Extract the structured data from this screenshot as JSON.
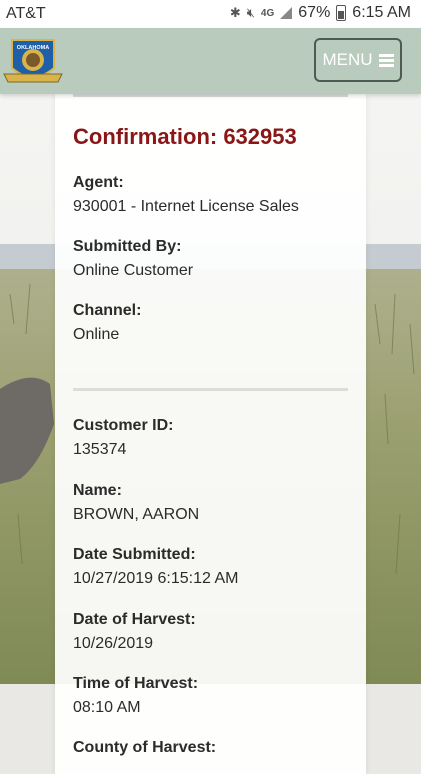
{
  "status_bar": {
    "carrier": "AT&T",
    "battery": "67%",
    "time": "6:15 AM",
    "network": "4G",
    "icons": [
      "bluetooth-icon",
      "mute-icon",
      "network-4g-icon",
      "signal-icon",
      "battery-icon"
    ]
  },
  "header": {
    "logo_text": "OKLAHOMA",
    "menu_label": "MENU",
    "background_color": "#b9cbbd"
  },
  "confirmation": {
    "title": "Confirmation: 632953",
    "title_color": "#8a1616"
  },
  "fields": [
    {
      "label": "Agent:",
      "value": "930001 - Internet License Sales"
    },
    {
      "label": "Submitted By:",
      "value": "Online Customer"
    },
    {
      "label": "Channel:",
      "value": "Online"
    },
    {
      "label": "Customer ID:",
      "value": "135374"
    },
    {
      "label": "Name:",
      "value": "BROWN, AARON"
    },
    {
      "label": "Date Submitted:",
      "value": "10/27/2019 6:15:12 AM"
    },
    {
      "label": "Date of Harvest:",
      "value": "10/26/2019"
    },
    {
      "label": "Time of Harvest:",
      "value": "08:10 AM"
    },
    {
      "label": "County of Harvest:",
      "value": ""
    }
  ]
}
